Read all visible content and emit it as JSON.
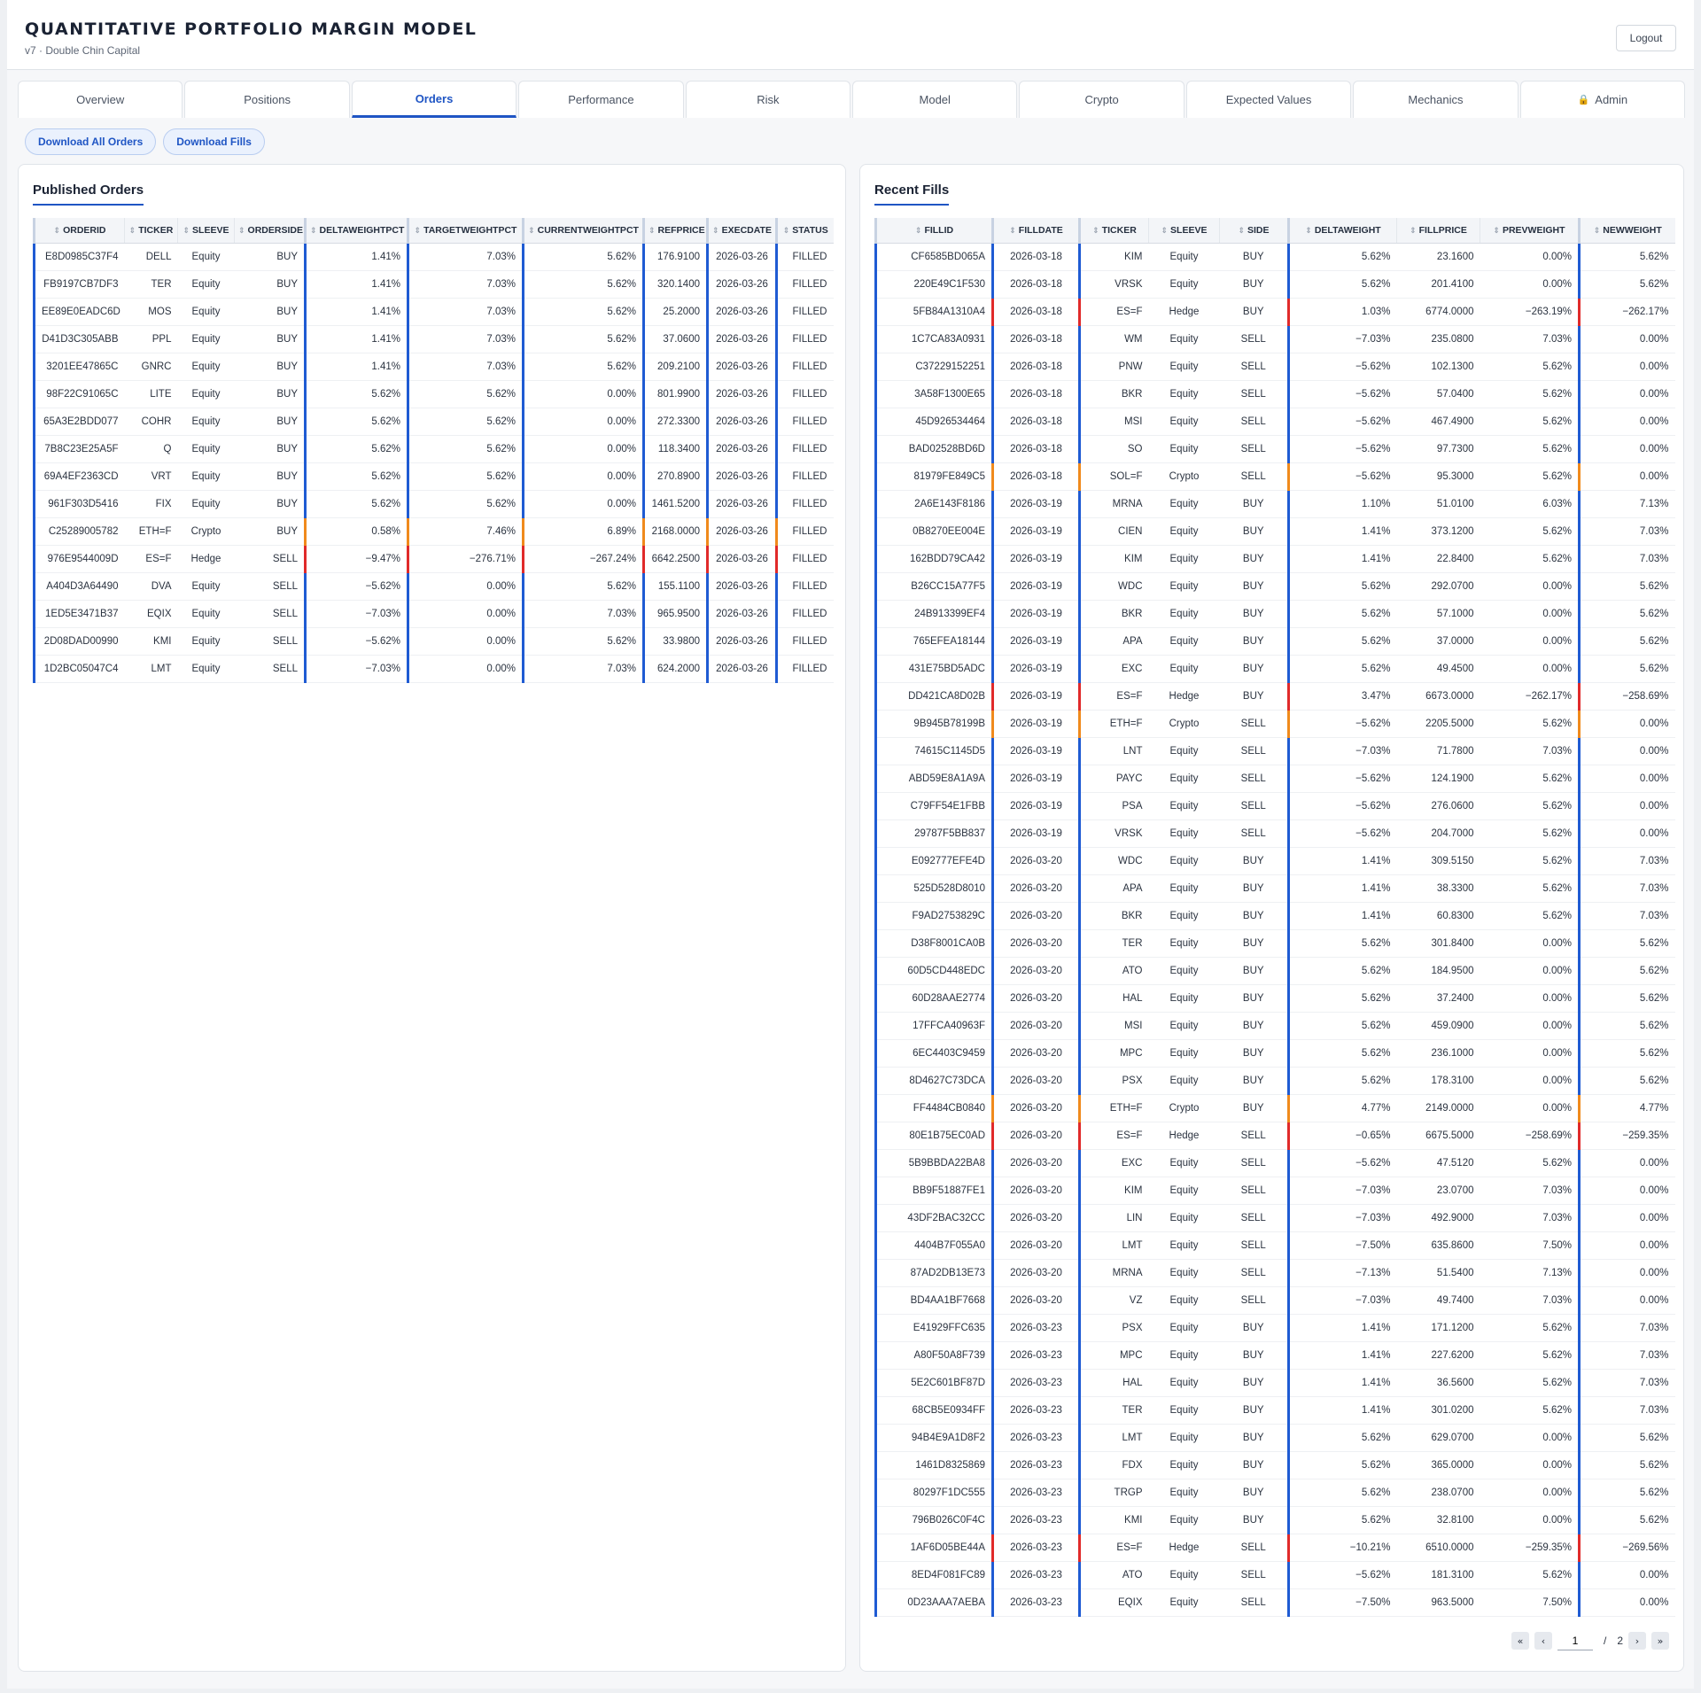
{
  "header": {
    "title": "QUANTITATIVE PORTFOLIO MARGIN MODEL",
    "subtitle": "v7 · Double Chin Capital",
    "logout_label": "Logout"
  },
  "tabs": [
    {
      "label": "Overview",
      "active": false
    },
    {
      "label": "Positions",
      "active": false
    },
    {
      "label": "Orders",
      "active": true
    },
    {
      "label": "Performance",
      "active": false
    },
    {
      "label": "Risk",
      "active": false
    },
    {
      "label": "Model",
      "active": false
    },
    {
      "label": "Crypto",
      "active": false
    },
    {
      "label": "Expected Values",
      "active": false
    },
    {
      "label": "Mechanics",
      "active": false
    },
    {
      "label": "Admin",
      "active": false,
      "icon": "lock-icon"
    }
  ],
  "actions": {
    "download_orders": "Download All Orders",
    "download_fills": "Download Fills"
  },
  "colors": {
    "accent": "#1f55c4",
    "equity_bar": "#1f5bd3",
    "crypto_bar": "#f08a1c",
    "hedge_bar": "#e02a2a"
  },
  "orders": {
    "title": "Published Orders",
    "columns": [
      "ORDERID",
      "TICKER",
      "SLEEVE",
      "ORDERSIDE",
      "DELTAWEIGHTPCT",
      "TARGETWEIGHTPCT",
      "CURRENTWEIGHTPCT",
      "REFPRICE",
      "EXECDATE",
      "STATUS"
    ],
    "rows": [
      [
        "E8D0985C37F4",
        "DELL",
        "Equity",
        "BUY",
        "1.41%",
        "7.03%",
        "5.62%",
        "176.9100",
        "2026-03-26",
        "FILLED"
      ],
      [
        "FB9197CB7DF3",
        "TER",
        "Equity",
        "BUY",
        "1.41%",
        "7.03%",
        "5.62%",
        "320.1400",
        "2026-03-26",
        "FILLED"
      ],
      [
        "EE89E0EADC6D",
        "MOS",
        "Equity",
        "BUY",
        "1.41%",
        "7.03%",
        "5.62%",
        "25.2000",
        "2026-03-26",
        "FILLED"
      ],
      [
        "D41D3C305ABB",
        "PPL",
        "Equity",
        "BUY",
        "1.41%",
        "7.03%",
        "5.62%",
        "37.0600",
        "2026-03-26",
        "FILLED"
      ],
      [
        "3201EE47865C",
        "GNRC",
        "Equity",
        "BUY",
        "1.41%",
        "7.03%",
        "5.62%",
        "209.2100",
        "2026-03-26",
        "FILLED"
      ],
      [
        "98F22C91065C",
        "LITE",
        "Equity",
        "BUY",
        "5.62%",
        "5.62%",
        "0.00%",
        "801.9900",
        "2026-03-26",
        "FILLED"
      ],
      [
        "65A3E2BDD077",
        "COHR",
        "Equity",
        "BUY",
        "5.62%",
        "5.62%",
        "0.00%",
        "272.3300",
        "2026-03-26",
        "FILLED"
      ],
      [
        "7B8C23E25A5F",
        "Q",
        "Equity",
        "BUY",
        "5.62%",
        "5.62%",
        "0.00%",
        "118.3400",
        "2026-03-26",
        "FILLED"
      ],
      [
        "69A4EF2363CD",
        "VRT",
        "Equity",
        "BUY",
        "5.62%",
        "5.62%",
        "0.00%",
        "270.8900",
        "2026-03-26",
        "FILLED"
      ],
      [
        "961F303D5416",
        "FIX",
        "Equity",
        "BUY",
        "5.62%",
        "5.62%",
        "0.00%",
        "1461.5200",
        "2026-03-26",
        "FILLED"
      ],
      [
        "C25289005782",
        "ETH=F",
        "Crypto",
        "BUY",
        "0.58%",
        "7.46%",
        "6.89%",
        "2168.0000",
        "2026-03-26",
        "FILLED"
      ],
      [
        "976E9544009D",
        "ES=F",
        "Hedge",
        "SELL",
        "−9.47%",
        "−276.71%",
        "−267.24%",
        "6642.2500",
        "2026-03-26",
        "FILLED"
      ],
      [
        "A404D3A64490",
        "DVA",
        "Equity",
        "SELL",
        "−5.62%",
        "0.00%",
        "5.62%",
        "155.1100",
        "2026-03-26",
        "FILLED"
      ],
      [
        "1ED5E3471B37",
        "EQIX",
        "Equity",
        "SELL",
        "−7.03%",
        "0.00%",
        "7.03%",
        "965.9500",
        "2026-03-26",
        "FILLED"
      ],
      [
        "2D08DAD00990",
        "KMI",
        "Equity",
        "SELL",
        "−5.62%",
        "0.00%",
        "5.62%",
        "33.9800",
        "2026-03-26",
        "FILLED"
      ],
      [
        "1D2BC05047C4",
        "LMT",
        "Equity",
        "SELL",
        "−7.03%",
        "0.00%",
        "7.03%",
        "624.2000",
        "2026-03-26",
        "FILLED"
      ]
    ]
  },
  "fills": {
    "title": "Recent Fills",
    "columns": [
      "FILLID",
      "FILLDATE",
      "TICKER",
      "SLEEVE",
      "SIDE",
      "DELTAWEIGHT",
      "FILLPRICE",
      "PREVWEIGHT",
      "NEWWEIGHT"
    ],
    "rows": [
      [
        "CF6585BD065A",
        "2026-03-18",
        "KIM",
        "Equity",
        "BUY",
        "5.62%",
        "23.1600",
        "0.00%",
        "5.62%"
      ],
      [
        "220E49C1F530",
        "2026-03-18",
        "VRSK",
        "Equity",
        "BUY",
        "5.62%",
        "201.4100",
        "0.00%",
        "5.62%"
      ],
      [
        "5FB84A1310A4",
        "2026-03-18",
        "ES=F",
        "Hedge",
        "BUY",
        "1.03%",
        "6774.0000",
        "−263.19%",
        "−262.17%"
      ],
      [
        "1C7CA83A0931",
        "2026-03-18",
        "WM",
        "Equity",
        "SELL",
        "−7.03%",
        "235.0800",
        "7.03%",
        "0.00%"
      ],
      [
        "C37229152251",
        "2026-03-18",
        "PNW",
        "Equity",
        "SELL",
        "−5.62%",
        "102.1300",
        "5.62%",
        "0.00%"
      ],
      [
        "3A58F1300E65",
        "2026-03-18",
        "BKR",
        "Equity",
        "SELL",
        "−5.62%",
        "57.0400",
        "5.62%",
        "0.00%"
      ],
      [
        "45D926534464",
        "2026-03-18",
        "MSI",
        "Equity",
        "SELL",
        "−5.62%",
        "467.4900",
        "5.62%",
        "0.00%"
      ],
      [
        "BAD02528BD6D",
        "2026-03-18",
        "SO",
        "Equity",
        "SELL",
        "−5.62%",
        "97.7300",
        "5.62%",
        "0.00%"
      ],
      [
        "81979FE849C5",
        "2026-03-18",
        "SOL=F",
        "Crypto",
        "SELL",
        "−5.62%",
        "95.3000",
        "5.62%",
        "0.00%"
      ],
      [
        "2A6E143F8186",
        "2026-03-19",
        "MRNA",
        "Equity",
        "BUY",
        "1.10%",
        "51.0100",
        "6.03%",
        "7.13%"
      ],
      [
        "0B8270EE004E",
        "2026-03-19",
        "CIEN",
        "Equity",
        "BUY",
        "1.41%",
        "373.1200",
        "5.62%",
        "7.03%"
      ],
      [
        "162BDD79CA42",
        "2026-03-19",
        "KIM",
        "Equity",
        "BUY",
        "1.41%",
        "22.8400",
        "5.62%",
        "7.03%"
      ],
      [
        "B26CC15A77F5",
        "2026-03-19",
        "WDC",
        "Equity",
        "BUY",
        "5.62%",
        "292.0700",
        "0.00%",
        "5.62%"
      ],
      [
        "24B913399EF4",
        "2026-03-19",
        "BKR",
        "Equity",
        "BUY",
        "5.62%",
        "57.1000",
        "0.00%",
        "5.62%"
      ],
      [
        "765EFEA18144",
        "2026-03-19",
        "APA",
        "Equity",
        "BUY",
        "5.62%",
        "37.0000",
        "0.00%",
        "5.62%"
      ],
      [
        "431E75BD5ADC",
        "2026-03-19",
        "EXC",
        "Equity",
        "BUY",
        "5.62%",
        "49.4500",
        "0.00%",
        "5.62%"
      ],
      [
        "DD421CA8D02B",
        "2026-03-19",
        "ES=F",
        "Hedge",
        "BUY",
        "3.47%",
        "6673.0000",
        "−262.17%",
        "−258.69%"
      ],
      [
        "9B945B78199B",
        "2026-03-19",
        "ETH=F",
        "Crypto",
        "SELL",
        "−5.62%",
        "2205.5000",
        "5.62%",
        "0.00%"
      ],
      [
        "74615C1145D5",
        "2026-03-19",
        "LNT",
        "Equity",
        "SELL",
        "−7.03%",
        "71.7800",
        "7.03%",
        "0.00%"
      ],
      [
        "ABD59E8A1A9A",
        "2026-03-19",
        "PAYC",
        "Equity",
        "SELL",
        "−5.62%",
        "124.1900",
        "5.62%",
        "0.00%"
      ],
      [
        "C79FF54E1FBB",
        "2026-03-19",
        "PSA",
        "Equity",
        "SELL",
        "−5.62%",
        "276.0600",
        "5.62%",
        "0.00%"
      ],
      [
        "29787F5BB837",
        "2026-03-19",
        "VRSK",
        "Equity",
        "SELL",
        "−5.62%",
        "204.7000",
        "5.62%",
        "0.00%"
      ],
      [
        "E092777EFE4D",
        "2026-03-20",
        "WDC",
        "Equity",
        "BUY",
        "1.41%",
        "309.5150",
        "5.62%",
        "7.03%"
      ],
      [
        "525D528D8010",
        "2026-03-20",
        "APA",
        "Equity",
        "BUY",
        "1.41%",
        "38.3300",
        "5.62%",
        "7.03%"
      ],
      [
        "F9AD2753829C",
        "2026-03-20",
        "BKR",
        "Equity",
        "BUY",
        "1.41%",
        "60.8300",
        "5.62%",
        "7.03%"
      ],
      [
        "D38F8001CA0B",
        "2026-03-20",
        "TER",
        "Equity",
        "BUY",
        "5.62%",
        "301.8400",
        "0.00%",
        "5.62%"
      ],
      [
        "60D5CD448EDC",
        "2026-03-20",
        "ATO",
        "Equity",
        "BUY",
        "5.62%",
        "184.9500",
        "0.00%",
        "5.62%"
      ],
      [
        "60D28AAE2774",
        "2026-03-20",
        "HAL",
        "Equity",
        "BUY",
        "5.62%",
        "37.2400",
        "0.00%",
        "5.62%"
      ],
      [
        "17FFCA40963F",
        "2026-03-20",
        "MSI",
        "Equity",
        "BUY",
        "5.62%",
        "459.0900",
        "0.00%",
        "5.62%"
      ],
      [
        "6EC4403C9459",
        "2026-03-20",
        "MPC",
        "Equity",
        "BUY",
        "5.62%",
        "236.1000",
        "0.00%",
        "5.62%"
      ],
      [
        "8D4627C73DCA",
        "2026-03-20",
        "PSX",
        "Equity",
        "BUY",
        "5.62%",
        "178.3100",
        "0.00%",
        "5.62%"
      ],
      [
        "FF4484CB0840",
        "2026-03-20",
        "ETH=F",
        "Crypto",
        "BUY",
        "4.77%",
        "2149.0000",
        "0.00%",
        "4.77%"
      ],
      [
        "80E1B75EC0AD",
        "2026-03-20",
        "ES=F",
        "Hedge",
        "SELL",
        "−0.65%",
        "6675.5000",
        "−258.69%",
        "−259.35%"
      ],
      [
        "5B9BBDA22BA8",
        "2026-03-20",
        "EXC",
        "Equity",
        "SELL",
        "−5.62%",
        "47.5120",
        "5.62%",
        "0.00%"
      ],
      [
        "BB9F51887FE1",
        "2026-03-20",
        "KIM",
        "Equity",
        "SELL",
        "−7.03%",
        "23.0700",
        "7.03%",
        "0.00%"
      ],
      [
        "43DF2BAC32CC",
        "2026-03-20",
        "LIN",
        "Equity",
        "SELL",
        "−7.03%",
        "492.9000",
        "7.03%",
        "0.00%"
      ],
      [
        "4404B7F055A0",
        "2026-03-20",
        "LMT",
        "Equity",
        "SELL",
        "−7.50%",
        "635.8600",
        "7.50%",
        "0.00%"
      ],
      [
        "87AD2DB13E73",
        "2026-03-20",
        "MRNA",
        "Equity",
        "SELL",
        "−7.13%",
        "51.5400",
        "7.13%",
        "0.00%"
      ],
      [
        "BD4AA1BF7668",
        "2026-03-20",
        "VZ",
        "Equity",
        "SELL",
        "−7.03%",
        "49.7400",
        "7.03%",
        "0.00%"
      ],
      [
        "E41929FFC635",
        "2026-03-23",
        "PSX",
        "Equity",
        "BUY",
        "1.41%",
        "171.1200",
        "5.62%",
        "7.03%"
      ],
      [
        "A80F50A8F739",
        "2026-03-23",
        "MPC",
        "Equity",
        "BUY",
        "1.41%",
        "227.6200",
        "5.62%",
        "7.03%"
      ],
      [
        "5E2C601BF87D",
        "2026-03-23",
        "HAL",
        "Equity",
        "BUY",
        "1.41%",
        "36.5600",
        "5.62%",
        "7.03%"
      ],
      [
        "68CB5E0934FF",
        "2026-03-23",
        "TER",
        "Equity",
        "BUY",
        "1.41%",
        "301.0200",
        "5.62%",
        "7.03%"
      ],
      [
        "94B4E9A1D8F2",
        "2026-03-23",
        "LMT",
        "Equity",
        "BUY",
        "5.62%",
        "629.0700",
        "0.00%",
        "5.62%"
      ],
      [
        "1461D8325869",
        "2026-03-23",
        "FDX",
        "Equity",
        "BUY",
        "5.62%",
        "365.0000",
        "0.00%",
        "5.62%"
      ],
      [
        "80297F1DC555",
        "2026-03-23",
        "TRGP",
        "Equity",
        "BUY",
        "5.62%",
        "238.0700",
        "0.00%",
        "5.62%"
      ],
      [
        "796B026C0F4C",
        "2026-03-23",
        "KMI",
        "Equity",
        "BUY",
        "5.62%",
        "32.8100",
        "0.00%",
        "5.62%"
      ],
      [
        "1AF6D05BE44A",
        "2026-03-23",
        "ES=F",
        "Hedge",
        "SELL",
        "−10.21%",
        "6510.0000",
        "−259.35%",
        "−269.56%"
      ],
      [
        "8ED4F081FC89",
        "2026-03-23",
        "ATO",
        "Equity",
        "SELL",
        "−5.62%",
        "181.3100",
        "5.62%",
        "0.00%"
      ],
      [
        "0D23AAA7AEBA",
        "2026-03-23",
        "EQIX",
        "Equity",
        "SELL",
        "−7.50%",
        "963.5000",
        "7.50%",
        "0.00%"
      ]
    ]
  },
  "pagination": {
    "current": "1",
    "separator": "/",
    "total": "2"
  }
}
